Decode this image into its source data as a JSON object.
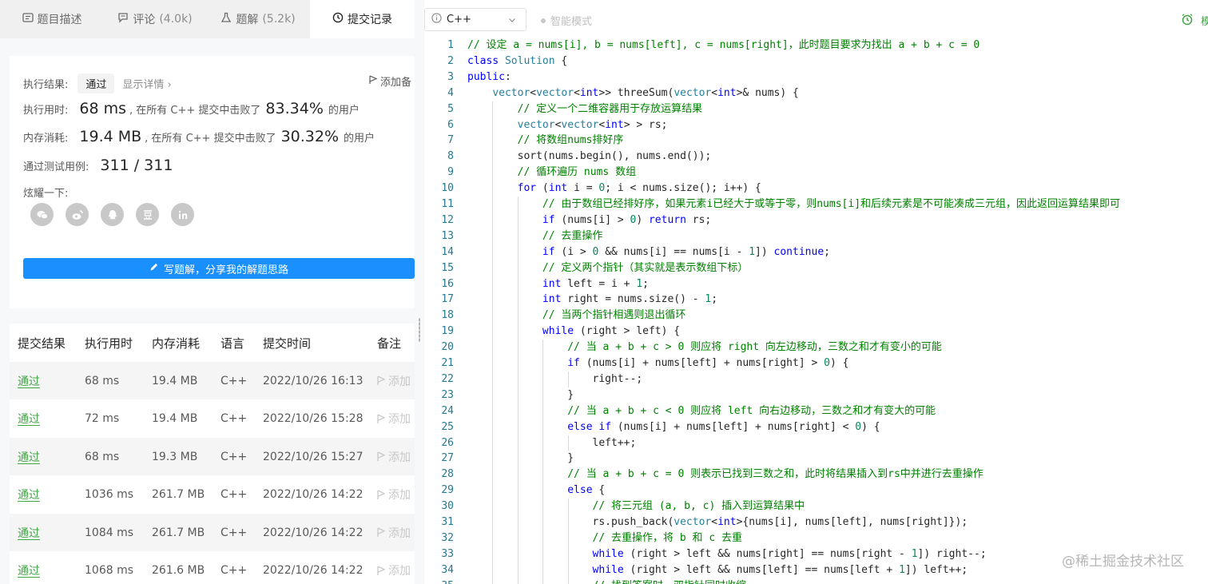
{
  "tabs": [
    {
      "label": "题目描述",
      "count": "",
      "icon": "description-icon"
    },
    {
      "label": "评论",
      "count": "(4.0k)",
      "icon": "comment-icon"
    },
    {
      "label": "题解",
      "count": "(5.2k)",
      "icon": "flask-icon"
    },
    {
      "label": "提交记录",
      "count": "",
      "icon": "clock-icon"
    }
  ],
  "result": {
    "exec_label": "执行结果:",
    "status": "通过",
    "detail_link": "显示详情 ›",
    "add_note": "添加备",
    "runtime_label": "执行用时:",
    "runtime": "68 ms",
    "runtime_mid": ", 在所有 C++ 提交中击败了",
    "runtime_pct": "83.34%",
    "runtime_suffix": "的用户",
    "memory_label": "内存消耗:",
    "memory": "19.4 MB",
    "memory_mid": ", 在所有 C++ 提交中击败了",
    "memory_pct": "30.32%",
    "memory_suffix": "的用户",
    "tests_label": "通过测试用例:",
    "tests": "311 / 311",
    "share_label": "炫耀一下:",
    "share_icons": [
      "wechat-icon",
      "weibo-icon",
      "qq-icon",
      "douban-icon",
      "linkedin-icon"
    ],
    "write_button": "写题解，分享我的解题思路"
  },
  "table": {
    "headers": [
      "提交结果",
      "执行用时",
      "内存消耗",
      "语言",
      "提交时间",
      "备注"
    ],
    "rows": [
      {
        "status": "通过",
        "runtime": "68 ms",
        "memory": "19.4 MB",
        "lang": "C++",
        "time": "2022/10/26 16:13",
        "note": "添加"
      },
      {
        "status": "通过",
        "runtime": "72 ms",
        "memory": "19.4 MB",
        "lang": "C++",
        "time": "2022/10/26 15:28",
        "note": "添加"
      },
      {
        "status": "通过",
        "runtime": "68 ms",
        "memory": "19.3 MB",
        "lang": "C++",
        "time": "2022/10/26 15:27",
        "note": "添加"
      },
      {
        "status": "通过",
        "runtime": "1036 ms",
        "memory": "261.7 MB",
        "lang": "C++",
        "time": "2022/10/26 14:22",
        "note": "添加"
      },
      {
        "status": "通过",
        "runtime": "1084 ms",
        "memory": "261.7 MB",
        "lang": "C++",
        "time": "2022/10/26 14:22",
        "note": "添加"
      },
      {
        "status": "通过",
        "runtime": "1068 ms",
        "memory": "261.6 MB",
        "lang": "C++",
        "time": "2022/10/26 14:22",
        "note": "添加"
      }
    ]
  },
  "toolbar": {
    "language": "C++",
    "smart_mode": "智能模式",
    "right_text": "模"
  },
  "code_lines": [
    "// 设定 a = nums[i], b = nums[left], c = nums[right]，此时题目要求为找出 a + b + c = 0",
    "class Solution {",
    "public:",
    "    vector<vector<int>> threeSum(vector<int>& nums) {",
    "        // 定义一个二维容器用于存放运算结果",
    "        vector<vector<int> > rs;",
    "        // 将数组nums排好序",
    "        sort(nums.begin(), nums.end());",
    "        // 循环遍历 nums 数组",
    "        for (int i = 0; i < nums.size(); i++) {",
    "            // 由于数组已经排好序，如果元素i已经大于或等于零，则nums[i]和后续元素是不可能凑成三元组，因此返回运算结果即可",
    "            if (nums[i] > 0) return rs;",
    "            // 去重操作",
    "            if (i > 0 && nums[i] == nums[i - 1]) continue;",
    "            // 定义两个指针（其实就是表示数组下标）",
    "            int left = i + 1;",
    "            int right = nums.size() - 1;",
    "            // 当两个指针相遇则退出循环",
    "            while (right > left) {",
    "                // 当 a + b + c > 0 则应将 right 向左边移动，三数之和才有变小的可能",
    "                if (nums[i] + nums[left] + nums[right] > 0) {",
    "                    right--;",
    "                }",
    "                // 当 a + b + c < 0 则应将 left 向右边移动，三数之和才有变大的可能",
    "                else if (nums[i] + nums[left] + nums[right] < 0) {",
    "                    left++;",
    "                }",
    "                // 当 a + b + c = 0 则表示已找到三数之和，此时将结果插入到rs中并进行去重操作",
    "                else {",
    "                    // 将三元组 (a, b, c) 插入到运算结果中",
    "                    rs.push_back(vector<int>{nums[i], nums[left], nums[right]});",
    "                    // 去重操作，将 b 和 c 去重",
    "                    while (right > left && nums[right] == nums[right - 1]) right--;",
    "                    while (right > left && nums[left] == nums[left + 1]) left++;",
    "                    // 找到答案时，双指针同时收缩"
  ],
  "watermark": "@稀土掘金技术社区"
}
